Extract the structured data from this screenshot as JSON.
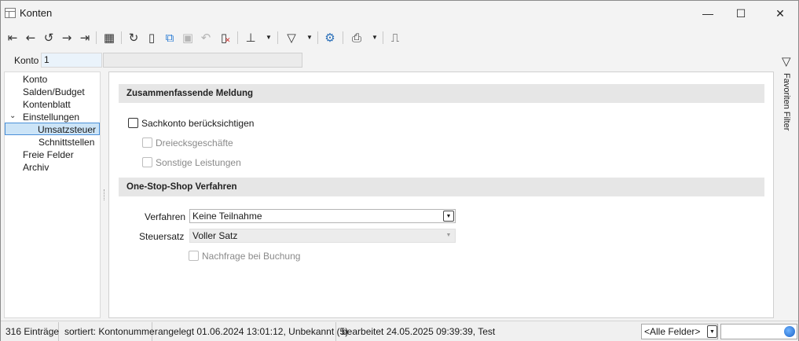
{
  "window": {
    "title": "Konten",
    "minimize_icon": "minimize-icon",
    "maximize_icon": "maximize-icon",
    "close_icon": "close-icon"
  },
  "toolbar": {
    "buttons": [
      {
        "name": "first-record-icon",
        "glyph": "|←"
      },
      {
        "name": "previous-record-icon",
        "glyph": "←"
      },
      {
        "name": "history-icon",
        "glyph": "⟲"
      },
      {
        "name": "next-record-icon",
        "glyph": "→"
      },
      {
        "name": "last-record-icon",
        "glyph": "→|"
      },
      {
        "name": "table-view-icon",
        "glyph": "▦"
      },
      {
        "name": "refresh-icon",
        "glyph": "↻"
      },
      {
        "name": "new-document-icon",
        "glyph": "🗋"
      },
      {
        "name": "copy-icon",
        "glyph": "⧉"
      },
      {
        "name": "save-icon",
        "glyph": "💾"
      },
      {
        "name": "undo-icon",
        "glyph": "↶"
      },
      {
        "name": "delete-icon",
        "glyph": "🗋"
      },
      {
        "name": "pin-icon",
        "glyph": "📌"
      },
      {
        "name": "filter-icon",
        "glyph": "⛛"
      },
      {
        "name": "settings-icon",
        "glyph": "⚙"
      },
      {
        "name": "print-icon",
        "glyph": "🖶"
      },
      {
        "name": "bookmark-icon",
        "glyph": "⎍"
      }
    ],
    "caret": "▼"
  },
  "konto": {
    "label": "Konto",
    "value": "1",
    "description": ""
  },
  "nav": {
    "items": [
      {
        "label": "Konto"
      },
      {
        "label": "Salden/Budget"
      },
      {
        "label": "Kontenblatt"
      },
      {
        "label": "Einstellungen"
      },
      {
        "label": "Umsatzsteuer"
      },
      {
        "label": "Schnittstellen"
      },
      {
        "label": "Freie Felder"
      },
      {
        "label": "Archiv"
      }
    ],
    "expand_glyph": "✓"
  },
  "main": {
    "section1": {
      "title": "Zusammenfassende Meldung",
      "checkboxes": [
        {
          "label": "Sachkonto berücksichtigen",
          "checked": false,
          "enabled": true
        },
        {
          "label": "Dreiecksgeschäfte",
          "checked": false,
          "enabled": false
        },
        {
          "label": "Sonstige Leistungen",
          "checked": false,
          "enabled": false
        }
      ]
    },
    "section2": {
      "title": "One-Stop-Shop Verfahren",
      "verfahren_label": "Verfahren",
      "verfahren_value": "Keine Teilnahme",
      "steuersatz_label": "Steuersatz",
      "steuersatz_value": "Voller Satz",
      "nachfrage_label": "Nachfrage bei Buchung"
    }
  },
  "side_panel": {
    "label": "Favoriten Filter",
    "icon": "filter-icon"
  },
  "status": {
    "count": "316 Einträge",
    "sort": "sortiert: Kontonummer",
    "created": "angelegt 01.06.2024 13:01:12, Unbekannt (5)",
    "edited": "bearbeitet 24.05.2025 09:39:39, Test",
    "field_select": "<Alle Felder>",
    "search_value": ""
  }
}
